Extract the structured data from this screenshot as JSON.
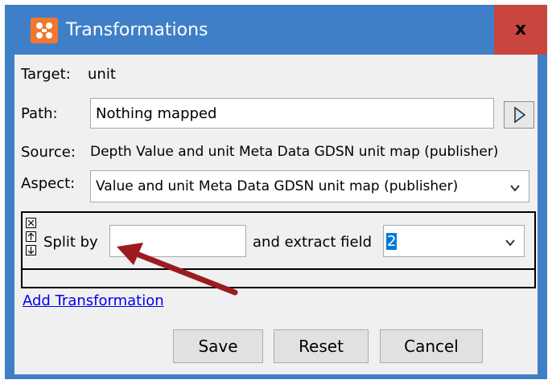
{
  "window": {
    "title": "Transformations",
    "icon": "app-grid-icon",
    "close_label": "x",
    "colors": {
      "titlebar": "#3f7fc8",
      "close": "#c8463d",
      "accent": "#0078d7",
      "annotation_arrow": "#9b1b1f"
    }
  },
  "target": {
    "label": "Target:",
    "value": "unit"
  },
  "path": {
    "label": "Path:",
    "value": "Nothing mapped"
  },
  "source": {
    "label": "Source:",
    "value": "Depth Value and unit Meta Data GDSN unit map (publisher)"
  },
  "aspect": {
    "label": "Aspect:",
    "value": "Value and unit Meta Data GDSN unit map (publisher)"
  },
  "transformation": {
    "split_label": "Split by",
    "split_value": "",
    "extract_label": "and extract field",
    "extract_value": "2"
  },
  "add_transformation_label": "Add Transformation",
  "buttons": {
    "save": "Save",
    "reset": "Reset",
    "cancel": "Cancel"
  }
}
